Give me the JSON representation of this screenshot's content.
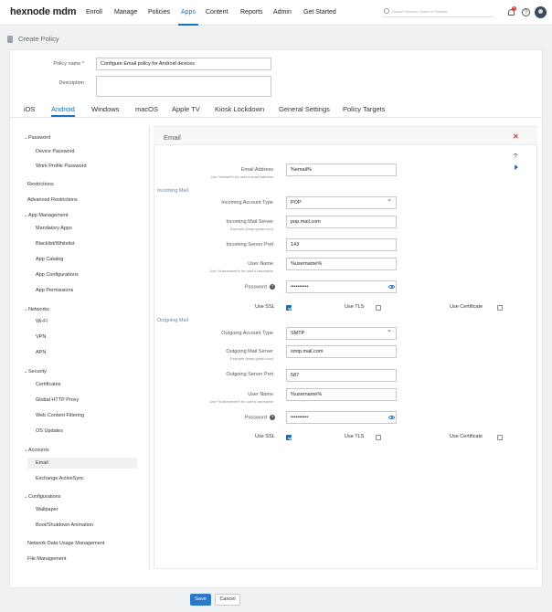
{
  "brand": {
    "logo": "hexnode mdm",
    "accent": "#1a6fc0"
  },
  "nav": {
    "items": [
      "Enroll",
      "Manage",
      "Policies",
      "Apps",
      "Content",
      "Reports",
      "Admin",
      "Get Started"
    ],
    "active": "Apps"
  },
  "search": {
    "placeholder": "Search Devices, Users or Policies"
  },
  "notifications": {
    "count": "9"
  },
  "page": {
    "title": "Create Policy"
  },
  "policy": {
    "name_label": "Policy name *",
    "name_value": "Configure Email policy for Android devices",
    "description_label": "Description",
    "description_value": ""
  },
  "platform_tabs": [
    "iOS",
    "Android",
    "Windows",
    "macOS",
    "Apple TV",
    "Kiosk Lockdown",
    "General Settings",
    "Policy Targets"
  ],
  "active_tab": "Android",
  "sidebar": {
    "groups": [
      {
        "label": "Password",
        "items": [
          "Device Password",
          "Work Profile Password"
        ]
      },
      {
        "label": "Restrictions",
        "items": []
      },
      {
        "label": "Advanced Restrictions",
        "items": []
      },
      {
        "label": "App Management",
        "items": [
          "Mandatory Apps",
          "Blacklist/Whitelist",
          "App Catalog",
          "App Configurations",
          "App Permissions"
        ]
      },
      {
        "label": "Networks",
        "items": [
          "Wi-Fi",
          "VPN",
          "APN"
        ]
      },
      {
        "label": "Security",
        "items": [
          "Certificates",
          "Global HTTP Proxy",
          "Web Content Filtering",
          "OS Updates"
        ]
      },
      {
        "label": "Accounts",
        "items": [
          "Email",
          "Exchange ActiveSync"
        ]
      },
      {
        "label": "Configurations",
        "items": [
          "Wallpaper",
          "Boot/Shutdown Animation"
        ]
      },
      {
        "label": "Network Data Usage Management",
        "items": []
      },
      {
        "label": "File Management",
        "items": []
      }
    ],
    "active_item": "Email"
  },
  "email": {
    "title": "Email",
    "address_label": "Email Address",
    "address_hint": "Use %email% for user's email address",
    "address_value": "%email%",
    "incoming": {
      "section": "Incoming Mail",
      "account_type_label": "Incoming Account Type",
      "account_type_value": "POP",
      "server_label": "Incoming Mail Server",
      "server_hint": "Example (imap.gmail.com)",
      "server_value": "pop.mail.com",
      "port_label": "Incoming Server Port",
      "port_value": "143",
      "username_label": "User Name",
      "username_hint": "Use %username% for user's username",
      "username_value": "%username%",
      "password_label": "Password",
      "password_value": "••••••••••",
      "ssl_label": "Use SSL",
      "tls_label": "Use TLS",
      "cert_label": "Use Certificate",
      "ssl": true,
      "tls": false,
      "cert": false
    },
    "outgoing": {
      "section": "Outgoing Mail",
      "account_type_label": "Outgoing Account Type",
      "account_type_value": "SMTP",
      "server_label": "Outgoing Mail Server",
      "server_hint": "Example (smtp.gmail.com)",
      "server_value": "smtp.mail.com",
      "port_label": "Outgoing Server Port",
      "port_value": "587",
      "username_label": "User Name",
      "username_hint": "Use %username% for user's username",
      "username_value": "%username%",
      "password_label": "Password",
      "password_value": "••••••••••",
      "ssl_label": "Use SSL",
      "tls_label": "Use TLS",
      "cert_label": "Use Certificate",
      "ssl": true,
      "tls": false,
      "cert": false
    }
  },
  "footer": {
    "save": "Save",
    "cancel": "Cancel"
  }
}
